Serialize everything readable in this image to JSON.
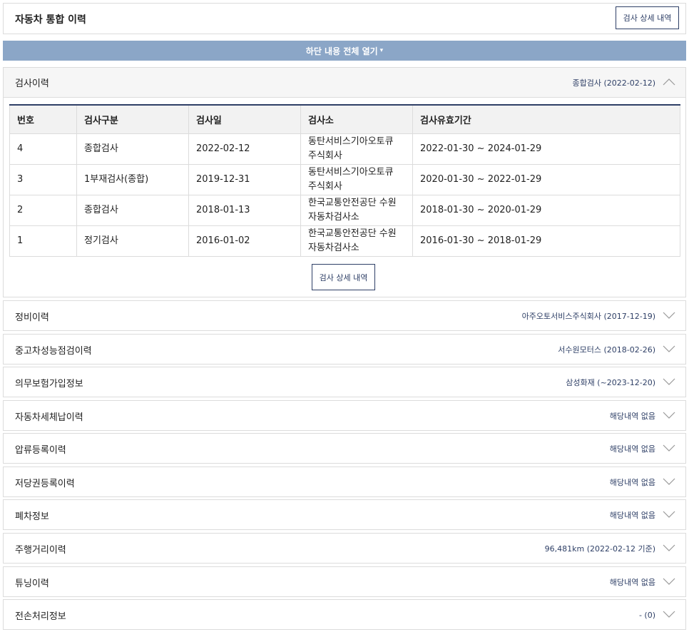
{
  "header": {
    "title": "자동차 통합 이력",
    "detail_button": "검사 상세 내역"
  },
  "expand_bar": {
    "label": "하단 내용 전체 열기",
    "caret": "▾"
  },
  "inspection": {
    "title": "검사이력",
    "summary": "종합검사 (2022-02-12)",
    "columns": [
      "번호",
      "검사구분",
      "검사일",
      "검사소",
      "검사유효기간"
    ],
    "rows": [
      [
        "4",
        "종합검사",
        "2022-02-12",
        "동탄서비스기아오토큐\n주식회사",
        "2022-01-30 ~ 2024-01-29"
      ],
      [
        "3",
        "1부재검사(종합)",
        "2019-12-31",
        "동탄서비스기아오토큐\n주식회사",
        "2020-01-30 ~ 2022-01-29"
      ],
      [
        "2",
        "종합검사",
        "2018-01-13",
        "한국교통안전공단 수원\n자동차검사소",
        "2018-01-30 ~ 2020-01-29"
      ],
      [
        "1",
        "정기검사",
        "2016-01-02",
        "한국교통안전공단 수원\n자동차검사소",
        "2016-01-30 ~ 2018-01-29"
      ]
    ],
    "detail_button": "검사 상세 내역"
  },
  "sections": [
    {
      "title": "정비이력",
      "summary": "아주오토서비스주식회사 (2017-12-19)"
    },
    {
      "title": "중고차성능점검이력",
      "summary": "서수원모터스 (2018-02-26)"
    },
    {
      "title": "의무보험가입정보",
      "summary": "삼성화재 (~2023-12-20)"
    },
    {
      "title": "자동차세체납이력",
      "summary": "해당내역 없음"
    },
    {
      "title": "압류등록이력",
      "summary": "해당내역 없음"
    },
    {
      "title": "저당권등록이력",
      "summary": "해당내역 없음"
    },
    {
      "title": "폐차정보",
      "summary": "해당내역 없음"
    },
    {
      "title": "주행거리이력",
      "summary": "96,481km (2022-02-12 기준)"
    },
    {
      "title": "튜닝이력",
      "summary": "해당내역 없음"
    },
    {
      "title": "전손처리정보",
      "summary": "- (0)"
    }
  ]
}
